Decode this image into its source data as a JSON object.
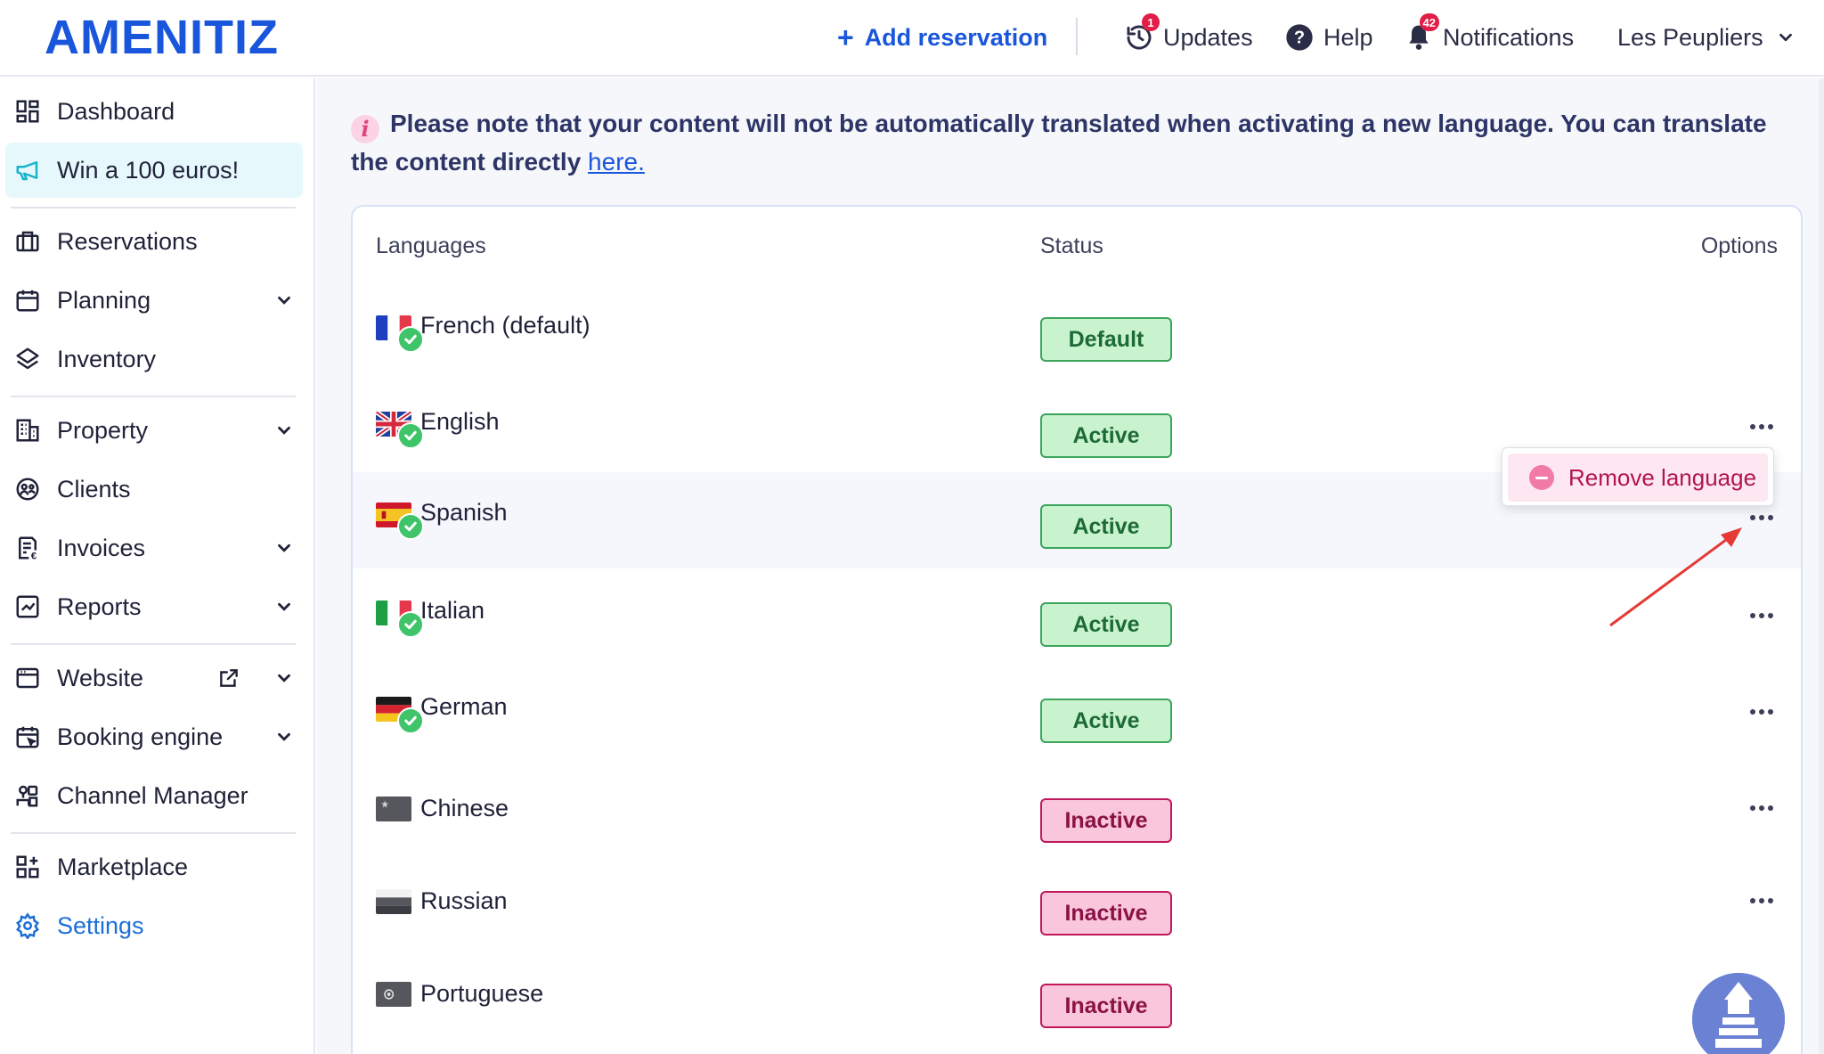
{
  "app": {
    "logo": "AMENITIZ",
    "brand_color": "#1a56db"
  },
  "topbar": {
    "add_reservation": "Add reservation",
    "updates": {
      "label": "Updates",
      "badge": "1"
    },
    "help": {
      "label": "Help"
    },
    "notifications": {
      "label": "Notifications",
      "badge": "42"
    },
    "property": {
      "label": "Les Peupliers"
    }
  },
  "sidebar": {
    "items": [
      {
        "label": "Dashboard",
        "icon": "dashboard-icon"
      },
      {
        "label": "Win a 100 euros!",
        "icon": "megaphone-icon"
      },
      {
        "label": "Reservations",
        "icon": "suitcase-icon"
      },
      {
        "label": "Planning",
        "icon": "calendar-icon"
      },
      {
        "label": "Inventory",
        "icon": "layers-icon"
      },
      {
        "label": "Property",
        "icon": "building-icon"
      },
      {
        "label": "Clients",
        "icon": "clients-icon"
      },
      {
        "label": "Invoices",
        "icon": "invoice-icon"
      },
      {
        "label": "Reports",
        "icon": "chart-icon"
      },
      {
        "label": "Website",
        "icon": "browser-icon"
      },
      {
        "label": "Booking engine",
        "icon": "booking-calendar-icon"
      },
      {
        "label": "Channel Manager",
        "icon": "channel-icon"
      },
      {
        "label": "Marketplace",
        "icon": "grid-plus-icon"
      },
      {
        "label": "Settings",
        "icon": "gear-icon"
      }
    ]
  },
  "notice": {
    "text": "Please note that your content will not be automatically translated when activating a new language. You can translate the content directly ",
    "link": "here."
  },
  "languages_table": {
    "headers": {
      "languages": "Languages",
      "status": "Status",
      "options": "Options"
    },
    "rows": [
      {
        "name": "French (default)",
        "status": "Default",
        "flag": "france-flag"
      },
      {
        "name": "English",
        "status": "Active",
        "flag": "uk-flag"
      },
      {
        "name": "Spanish",
        "status": "Active",
        "flag": "spain-flag"
      },
      {
        "name": "Italian",
        "status": "Active",
        "flag": "italy-flag"
      },
      {
        "name": "German",
        "status": "Active",
        "flag": "germany-flag"
      },
      {
        "name": "Chinese",
        "status": "Inactive",
        "flag": "china-flag"
      },
      {
        "name": "Russian",
        "status": "Inactive",
        "flag": "russia-flag"
      },
      {
        "name": "Portuguese",
        "status": "Inactive",
        "flag": "portugal-flag"
      }
    ]
  },
  "options_menu": {
    "remove_language": "Remove language"
  },
  "colors": {
    "active_bg": "#c9f2cf",
    "active_border": "#3ba55c",
    "inactive_bg": "#f9c6dc",
    "inactive_border": "#c2185b",
    "settings_active": "#1a6fd8",
    "annotation_arrow": "#e53935"
  }
}
